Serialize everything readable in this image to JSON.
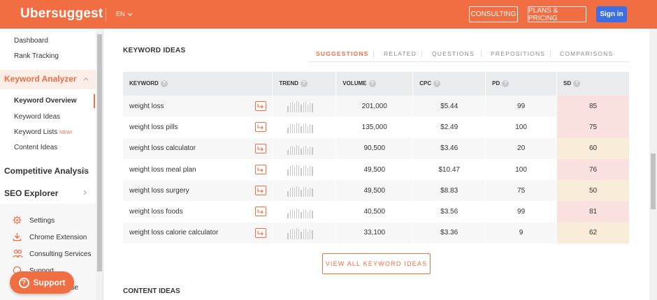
{
  "topbar": {
    "logo": "Ubersuggest",
    "lang": "EN",
    "consulting": "CONSULTING",
    "plans": "PLANS & PRICING",
    "signin": "Sign in",
    "color": "#f16d42"
  },
  "sidebar": {
    "dashboard": "Dashboard",
    "rank_tracking": "Rank Tracking",
    "keyword_analyzer": "Keyword Analyzer",
    "keyword_overview": "Keyword Overview",
    "keyword_ideas": "Keyword Ideas",
    "keyword_lists": "Keyword Lists",
    "new_badge": "NEW!",
    "content_ideas": "Content Ideas",
    "competitive_analysis": "Competitive Analysis",
    "seo_explorer": "SEO Explorer",
    "settings": "Settings",
    "chrome_extension": "Chrome Extension",
    "consulting_services": "Consulting Services",
    "support_link": "Support",
    "partial_item": "ase"
  },
  "support_button": "Support",
  "section": {
    "keyword_ideas_title": "KEYWORD IDEAS",
    "content_ideas_title": "CONTENT IDEAS",
    "view_all": "VIEW ALL KEYWORD IDEAS"
  },
  "tabs": [
    "SUGGESTIONS",
    "RELATED",
    "QUESTIONS",
    "PREPOSITIONS",
    "COMPARISONS"
  ],
  "table": {
    "headers": [
      "KEYWORD",
      "TREND",
      "VOLUME",
      "CPC",
      "PD",
      "SD"
    ],
    "rows": [
      {
        "keyword": "weight loss",
        "volume": "201,000",
        "cpc": "$5.44",
        "pd": "99",
        "sd": "85",
        "sd_color": "#fbe0e0"
      },
      {
        "keyword": "weight loss pills",
        "volume": "135,000",
        "cpc": "$2.49",
        "pd": "100",
        "sd": "75",
        "sd_color": "#fbe0e0"
      },
      {
        "keyword": "weight loss calculator",
        "volume": "90,500",
        "cpc": "$3.46",
        "pd": "20",
        "sd": "60",
        "sd_color": "#f9ecd9"
      },
      {
        "keyword": "weight loss meal plan",
        "volume": "49,500",
        "cpc": "$10.47",
        "pd": "100",
        "sd": "76",
        "sd_color": "#fbe0e0"
      },
      {
        "keyword": "weight loss surgery",
        "volume": "49,500",
        "cpc": "$8.83",
        "pd": "75",
        "sd": "50",
        "sd_color": "#f9ecd9"
      },
      {
        "keyword": "weight loss foods",
        "volume": "40,500",
        "cpc": "$3.56",
        "pd": "99",
        "sd": "81",
        "sd_color": "#fbe0e0"
      },
      {
        "keyword": "weight loss calorie calculator",
        "volume": "33,100",
        "cpc": "$3.36",
        "pd": "9",
        "sd": "62",
        "sd_color": "#f9ecd9"
      }
    ]
  }
}
